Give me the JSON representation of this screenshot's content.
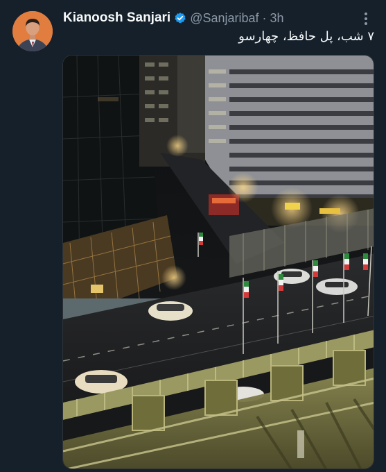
{
  "tweet": {
    "display_name": "Kianoosh Sanjari",
    "handle": "@Sanjaribaf",
    "separator": "·",
    "time": "3h",
    "text": "۷ شب، پل حافظ، چهارسو",
    "verified": true
  },
  "icons": {
    "verified": "verified-badge-icon",
    "more": "more-options-icon"
  },
  "colors": {
    "background": "#15202b",
    "name": "#f7f9f9",
    "muted": "#8b98a5",
    "verified": "#1d9bf0"
  }
}
